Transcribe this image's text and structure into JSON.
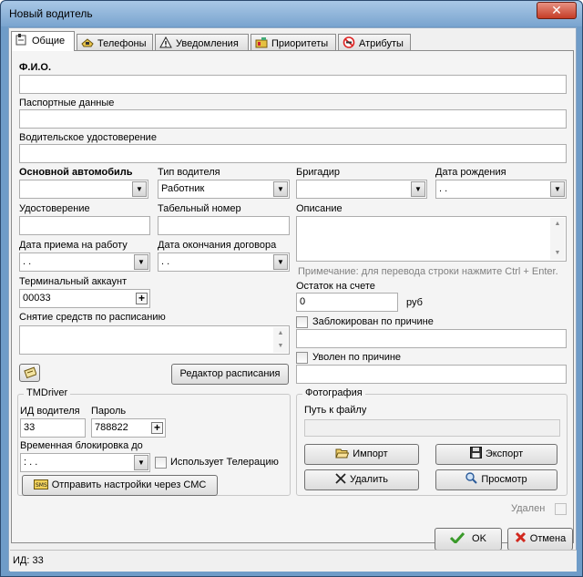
{
  "window": {
    "title": "Новый водитель",
    "close_label": "✕"
  },
  "tabs": [
    {
      "label": "Общие",
      "icon": "general-icon"
    },
    {
      "label": "Телефоны",
      "icon": "phone-icon"
    },
    {
      "label": "Уведомления",
      "icon": "warning-icon"
    },
    {
      "label": "Приоритеты",
      "icon": "priority-icon"
    },
    {
      "label": "Атрибуты",
      "icon": "no-entry-icon"
    }
  ],
  "form": {
    "fio_label": "Ф.И.О.",
    "fio_value": "",
    "passport_label": "Паспортные данные",
    "passport_value": "",
    "license_label": "Водительское удостоверение",
    "license_value": "",
    "main_car_label": "Основной автомобиль",
    "main_car_value": "",
    "driver_type_label": "Тип водителя",
    "driver_type_value": "Работник",
    "brigadier_label": "Бригадир",
    "brigadier_value": "",
    "birth_date_label": "Дата рождения",
    "birth_date_value": " .  .",
    "certificate_label": "Удостоверение",
    "certificate_value": "",
    "tab_number_label": "Табельный номер",
    "tab_number_value": "",
    "description_label": "Описание",
    "description_value": "",
    "hire_date_label": "Дата приема на работу",
    "hire_date_value": " .  .",
    "contract_end_label": "Дата окончания договора",
    "contract_end_value": " .  .",
    "hint": "Примечание: для перевода строки нажмите Ctrl + Enter.",
    "terminal_account_label": "Терминальный аккаунт",
    "terminal_account_value": "00033",
    "balance_label": "Остаток на счете",
    "balance_value": "0",
    "balance_unit": "руб",
    "schedule_charge_label": "Снятие средств по расписанию",
    "schedule_charge_value": "",
    "blocked_label": "Заблокирован по причине",
    "blocked_reason": "",
    "fired_label": "Уволен по причине",
    "fired_reason": "",
    "schedule_editor_button": "Редактор расписания"
  },
  "tmdriver": {
    "title": "TMDriver",
    "driver_id_label": "ИД водителя",
    "driver_id_value": "33",
    "password_label": "Пароль",
    "password_value": "788822",
    "temp_block_label": "Временная блокировка до",
    "temp_block_value": "  :    .  .",
    "telerelay_label": "Использует Телерацию",
    "send_sms_button": "Отправить настройки через СМС"
  },
  "photo": {
    "title": "Фотография",
    "path_label": "Путь к файлу",
    "path_value": "",
    "import_button": "Импорт",
    "export_button": "Экспорт",
    "delete_button": "Удалить",
    "view_button": "Просмотр"
  },
  "deleted_label": "Удален",
  "footer": {
    "ok_button": "OK",
    "cancel_button": "Отмена"
  },
  "status": {
    "id_text": "ИД: 33"
  }
}
